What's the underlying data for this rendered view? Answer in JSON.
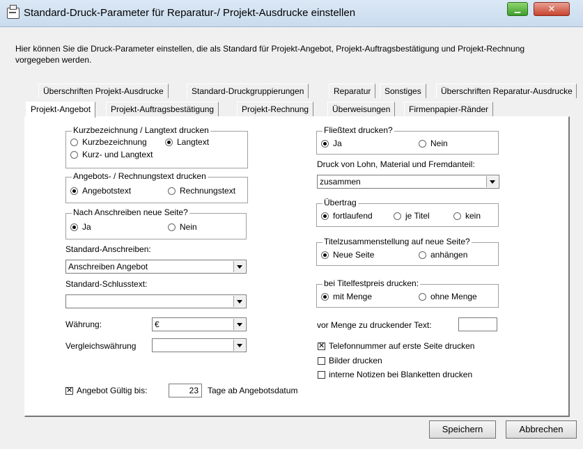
{
  "window": {
    "title": "Standard-Druck-Parameter für Reparatur-/ Projekt-Ausdrucke einstellen",
    "min_icon": "minimize-icon",
    "close_icon": "close-icon"
  },
  "description": "Hier können Sie die Druck-Parameter einstellen, die als Standard für Projekt-Angebot, Projekt-Auftragsbestätigung und Projekt-Rechnung vorgegeben werden.",
  "tabs_row1": [
    "Überschriften Projekt-Ausdrucke",
    "Standard-Druckgruppierungen",
    "Reparatur",
    "Sonstiges",
    "Überschriften Reparatur-Ausdrucke"
  ],
  "tabs_row2": [
    "Projekt-Angebot",
    "Projekt-Auftragsbestätigung",
    "Projekt-Rechnung",
    "Überweisungen",
    "Firmenpapier-Ränder"
  ],
  "active_tab": "Projekt-Angebot",
  "kurz": {
    "legend": "Kurzbezeichnung / Langtext drucken",
    "opt1": "Kurzbezeichnung",
    "opt2": "Langtext",
    "opt3": "Kurz- und Langtext",
    "selected": "Langtext"
  },
  "angebotstext": {
    "legend": "Angebots- / Rechnungstext drucken",
    "opt1": "Angebotstext",
    "opt2": "Rechnungstext",
    "selected": "Angebotstext"
  },
  "neue_seite": {
    "legend": "Nach Anschreiben neue Seite?",
    "opt1": "Ja",
    "opt2": "Nein",
    "selected": "Ja"
  },
  "anschreiben": {
    "label": "Standard-Anschreiben:",
    "value": "Anschreiben Angebot"
  },
  "schlusstext": {
    "label": "Standard-Schlusstext:",
    "value": ""
  },
  "waehrung": {
    "label": "Währung:",
    "value": "€"
  },
  "vergleich": {
    "label": "Vergleichswährung",
    "value": ""
  },
  "gueltig": {
    "label": "Angebot Gültig bis:",
    "days": "23",
    "suffix": "Tage ab Angebotsdatum",
    "checked": true
  },
  "fliesstext": {
    "legend": "Fließtext drucken?",
    "opt1": "Ja",
    "opt2": "Nein",
    "selected": "Ja"
  },
  "lohn": {
    "label": "Druck von Lohn, Material und Fremdanteil:",
    "value": "zusammen"
  },
  "uebertrag": {
    "legend": "Übertrag",
    "opt1": "fortlaufend",
    "opt2": "je Titel",
    "opt3": "kein",
    "selected": "fortlaufend"
  },
  "titelzus": {
    "legend": "Titelzusammenstellung auf neue Seite?",
    "opt1": "Neue Seite",
    "opt2": "anhängen",
    "selected": "Neue Seite"
  },
  "festpreis": {
    "legend": "bei Titelfestpreis drucken:",
    "opt1": "mit Menge",
    "opt2": "ohne Menge",
    "selected": "mit Menge"
  },
  "vor_menge": {
    "label": "vor Menge zu druckender Text:",
    "value": ""
  },
  "checks": [
    {
      "label": "Telefonnummer auf erste Seite drucken",
      "checked": true
    },
    {
      "label": "Bilder drucken",
      "checked": false
    },
    {
      "label": "interne Notizen bei Blanketten drucken",
      "checked": false
    }
  ],
  "buttons": {
    "save": "Speichern",
    "cancel": "Abbrechen"
  }
}
